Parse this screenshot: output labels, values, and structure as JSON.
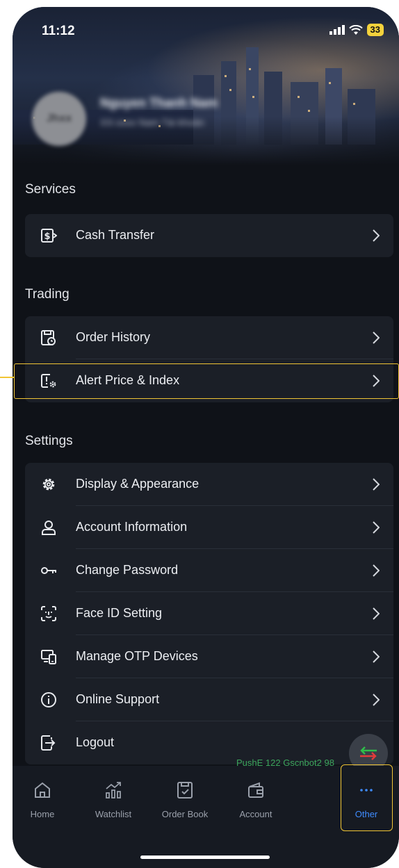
{
  "status": {
    "time": "11:12",
    "battery": "33"
  },
  "profile": {
    "initials": "Jhxx",
    "name": "Nguyen Thanh Nam",
    "sub": "XX-xxxx Nam Tài khoản"
  },
  "sections": {
    "services": {
      "title": "Services",
      "items": [
        {
          "label": "Cash Transfer",
          "icon": "cash-transfer-icon"
        }
      ]
    },
    "trading": {
      "title": "Trading",
      "items": [
        {
          "label": "Order History",
          "icon": "order-history-icon"
        },
        {
          "label": "Alert Price & Index",
          "icon": "alert-settings-icon"
        }
      ]
    },
    "settings": {
      "title": "Settings",
      "items": [
        {
          "label": "Display & Appearance",
          "icon": "gear-icon"
        },
        {
          "label": "Account Information",
          "icon": "user-icon"
        },
        {
          "label": "Change Password",
          "icon": "key-icon"
        },
        {
          "label": "Face ID Setting",
          "icon": "face-id-icon"
        },
        {
          "label": "Manage OTP Devices",
          "icon": "devices-icon"
        },
        {
          "label": "Online Support",
          "icon": "info-icon"
        },
        {
          "label": "Logout",
          "icon": "logout-icon"
        }
      ]
    }
  },
  "marquee": "PushE 122 Gscnbot2 98",
  "tabs": [
    {
      "label": "Home",
      "icon": "home-icon"
    },
    {
      "label": "Watchlist",
      "icon": "watchlist-chart-icon"
    },
    {
      "label": "Order Book",
      "icon": "order-book-icon"
    },
    {
      "label": "Account",
      "icon": "wallet-icon"
    },
    {
      "label": "Other",
      "icon": "more-dots-icon",
      "active": true
    }
  ],
  "colors": {
    "accent": "#3f8cff",
    "highlight": "#f1c535",
    "card": "#1b1f27"
  }
}
